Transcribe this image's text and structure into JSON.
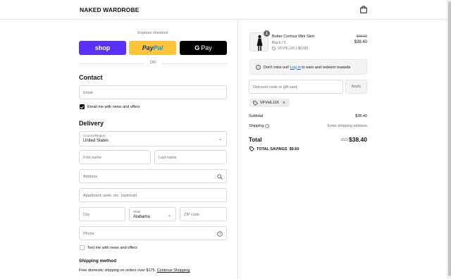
{
  "header": {
    "brand": "NAKED WARDROBE",
    "bag_icon": "shopping-bag-icon"
  },
  "express": {
    "label": "Express checkout",
    "shop_label": "shop",
    "paypal_label_1": "Pay",
    "paypal_label_2": "Pal",
    "gpay_g": "G",
    "gpay_label": "Pay",
    "or_label": "OR"
  },
  "contact": {
    "title": "Contact",
    "email_placeholder": "Email",
    "news_label": "Email me with news and offers",
    "news_checked": true
  },
  "delivery": {
    "title": "Delivery",
    "country_label": "Country/Region",
    "country_value": "United States",
    "first_name_placeholder": "First name",
    "last_name_placeholder": "Last name",
    "address_placeholder": "Address",
    "apartment_placeholder": "Apartment, suite, etc. (optional)",
    "city_placeholder": "City",
    "state_label": "State",
    "state_value": "Alabama",
    "zip_placeholder": "ZIP code",
    "phone_placeholder": "Phone",
    "text_label": "Text me with news and offers",
    "text_checked": false
  },
  "shipping": {
    "title": "Shipping method",
    "note": "Free domestic shipping on orders over $175.",
    "link": "Continue Shopping"
  },
  "summary": {
    "product": {
      "name": "Butter Contour Mini Skirt",
      "variant": "Black / S",
      "discount_code": "VFVHLJJX (-$9.60)",
      "original_price": "$48.00",
      "price": "$38.40",
      "quantity": "1"
    },
    "rewards": {
      "prefix": "Don't miss out!",
      "link": "Log in",
      "suffix": "to earn and redeem rewards"
    },
    "discount_placeholder": "Discount code or gift card",
    "apply_label": "Apply",
    "applied_code": "VFVHLJJX",
    "subtotal_label": "Subtotal",
    "subtotal_value": "$38.40",
    "shipping_label": "Shipping",
    "shipping_value": "Enter shipping address",
    "total_label": "Total",
    "currency": "USD",
    "total_value": "$38.40",
    "savings_label": "TOTAL SAVINGS",
    "savings_value": "$9.60"
  },
  "colors": {
    "shop_purple": "#5a31f4",
    "paypal_yellow": "#ffc439",
    "gpay_black": "#000000",
    "link_blue": "#1a5fd0"
  }
}
